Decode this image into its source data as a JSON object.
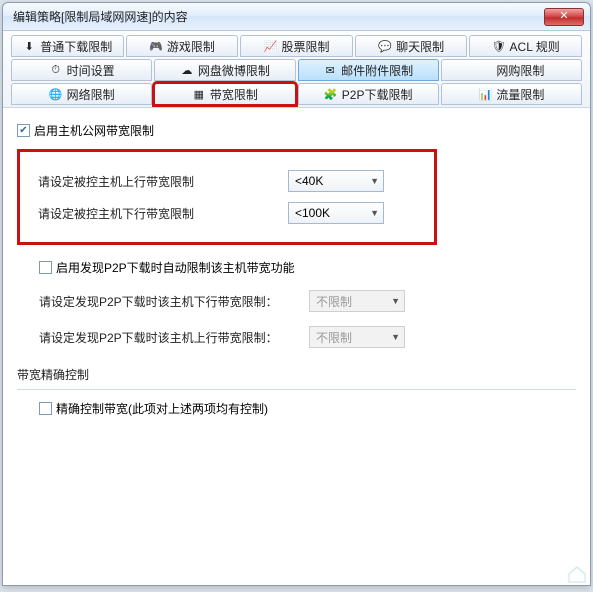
{
  "window": {
    "title": "编辑策略[限制局域网网速]的内容"
  },
  "tabs": {
    "row1": [
      {
        "label": "普通下载限制",
        "icon": "⬇"
      },
      {
        "label": "游戏限制",
        "icon": "🎮"
      },
      {
        "label": "股票限制",
        "icon": "📈"
      },
      {
        "label": "聊天限制",
        "icon": "💬"
      },
      {
        "label": "ACL 规则",
        "icon": "🛡"
      }
    ],
    "row2": [
      {
        "label": "时间设置",
        "icon": "⏱"
      },
      {
        "label": "网盘微博限制",
        "icon": "☁"
      },
      {
        "label": "邮件附件限制",
        "icon": "✉",
        "active": true
      },
      {
        "label": "网购限制",
        "icon": ""
      }
    ],
    "row3": [
      {
        "label": "网络限制",
        "icon": "🌐"
      },
      {
        "label": "带宽限制",
        "icon": "▦",
        "highlight": true
      },
      {
        "label": "P2P下载限制",
        "icon": "🧩"
      },
      {
        "label": "流量限制",
        "icon": "📊"
      }
    ]
  },
  "main": {
    "enable_checkbox_label": "启用主机公网带宽限制",
    "enable_checked": true,
    "uplink_label": "请设定被控主机上行带宽限制",
    "uplink_value": "<40K",
    "downlink_label": "请设定被控主机下行带宽限制",
    "downlink_value": "<100K",
    "p2p_auto_label": "启用发现P2P下载时自动限制该主机带宽功能",
    "p2p_auto_checked": false,
    "p2p_down_label": "请设定发现P2P下载时该主机下行带宽限制：",
    "p2p_down_value": "不限制",
    "p2p_up_label": "请设定发现P2P下载时该主机上行带宽限制：",
    "p2p_up_value": "不限制",
    "precise_group_title": "带宽精确控制",
    "precise_checkbox_label": "精确控制带宽(此项对上述两项均有控制)",
    "precise_checked": false
  }
}
